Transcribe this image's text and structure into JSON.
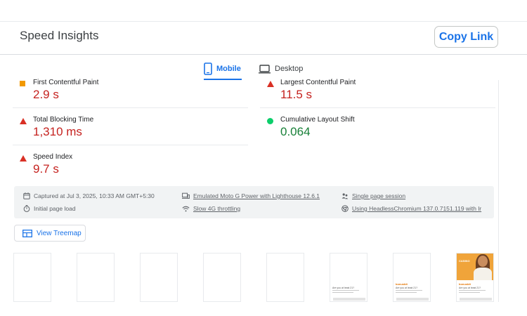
{
  "header": {
    "title": "Speed Insights",
    "copy_link_label": "Copy Link"
  },
  "tabs": [
    {
      "label": "Mobile",
      "active": true,
      "icon": "smartphone-icon"
    },
    {
      "label": "Desktop",
      "active": false,
      "icon": "desktop-icon"
    }
  ],
  "metrics": {
    "fcp": {
      "label": "First Contentful Paint",
      "value": "2.9 s",
      "status": "average",
      "indicator": "orange-square"
    },
    "lcp": {
      "label": "Largest Contentful Paint",
      "value": "11.5 s",
      "status": "poor",
      "indicator": "red-triangle"
    },
    "tbt": {
      "label": "Total Blocking Time",
      "value": "1,310 ms",
      "status": "poor",
      "indicator": "red-triangle"
    },
    "cls": {
      "label": "Cumulative Layout Shift",
      "value": "0.064",
      "status": "good",
      "indicator": "green-circle"
    },
    "si": {
      "label": "Speed Index",
      "value": "9.7 s",
      "status": "poor",
      "indicator": "red-triangle"
    }
  },
  "info": {
    "captured": "Captured at Jul 3, 2025, 10:33 AM GMT+5:30",
    "load": "Initial page load",
    "device": "Emulated Moto G Power with Lighthouse 12.6.1",
    "throttling": "Slow 4G throttling",
    "session": "Single page session",
    "browser": "Using HeadlessChromium 137.0.7151.119 with lr"
  },
  "treemap": {
    "label": "View Treemap"
  },
  "colors": {
    "accent": "#1a73e8",
    "poor": "#c5221f",
    "good": "#188038",
    "average": "#f29900"
  },
  "filmstrip": {
    "frames": 8,
    "frame_texts": {
      "logo": "bonusbit",
      "heading": "Are you at least 21?",
      "hero": "CASINO"
    }
  }
}
